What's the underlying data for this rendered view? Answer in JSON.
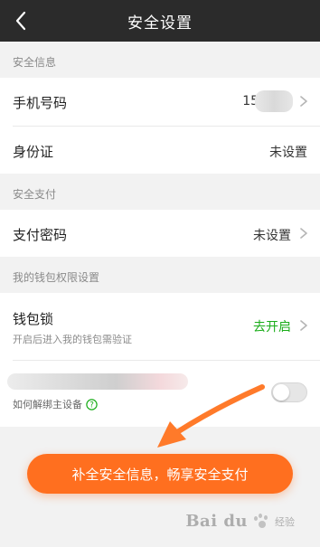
{
  "header": {
    "title": "安全设置"
  },
  "sections": {
    "security_info": "安全信息",
    "security_payment": "安全支付",
    "wallet_permission": "我的钱包权限设置"
  },
  "rows": {
    "phone": {
      "label": "手机号码",
      "value": "159***"
    },
    "id_card": {
      "label": "身份证",
      "value": "未设置"
    },
    "pay_password": {
      "label": "支付密码",
      "value": "未设置"
    },
    "wallet_lock": {
      "label": "钱包锁",
      "subtitle": "开启后进入我的钱包需验证",
      "action": "去开启"
    },
    "device": {
      "help": "如何解绑主设备",
      "toggle_on": false
    }
  },
  "cta": {
    "label": "补全安全信息，畅享安全支付"
  },
  "watermark": {
    "logo": "Bai du",
    "sub": "经验"
  },
  "colors": {
    "nav_bg": "#2b2b2b",
    "accent_green": "#1aad19",
    "cta_orange": "#ff6f1f",
    "section_text": "#8a8a8a",
    "page_bg": "#f2f2f2"
  },
  "icons": {
    "back": "chevron-left-icon",
    "row_arrow": "chevron-right-icon",
    "help": "question-circle-icon",
    "annotation": "orange-arrow-icon"
  }
}
